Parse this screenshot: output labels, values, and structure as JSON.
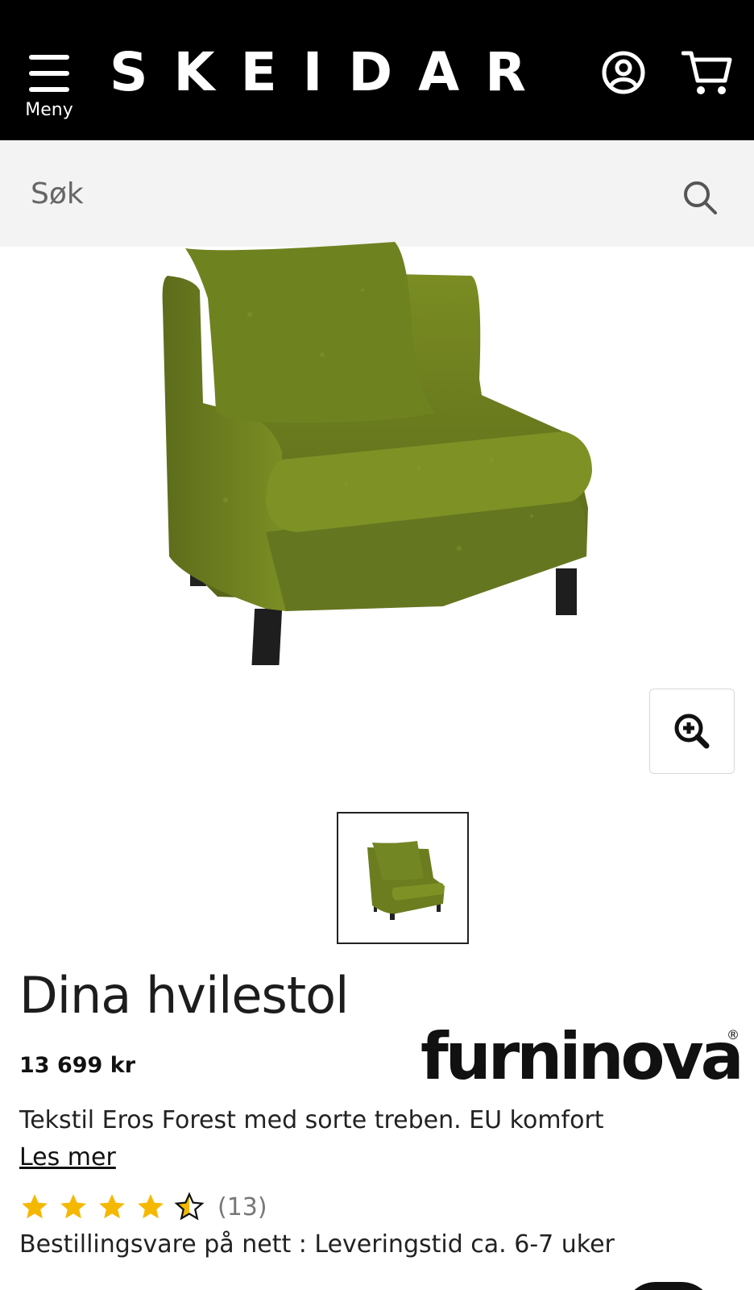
{
  "header": {
    "menu_label": "Meny",
    "logo_text": "SKEIDAR",
    "account_icon": "user-circle-icon",
    "cart_icon": "cart-icon",
    "background_color": "#000000"
  },
  "search": {
    "placeholder": "Søk",
    "icon": "search-icon"
  },
  "product": {
    "image_alt": "green velvet armchair",
    "zoom_icon": "zoom-in-icon",
    "thumbnail_count": 1,
    "title": "Dina hvilestol",
    "price": "13 699 kr",
    "brand": "furninova",
    "brand_mark": "®",
    "description": "Tekstil Eros Forest med sorte treben. EU komfort",
    "read_more": "Les mer",
    "rating": {
      "value": 4.5,
      "max": 5,
      "count_label": "(13)",
      "star_color": "#f5b800"
    },
    "delivery": "Bestillingsvare på nett : Leveringstid ca. 6-7 uker"
  },
  "colors": {
    "chair_green": "#6b7d1f",
    "search_bg": "#f3f3f3"
  }
}
